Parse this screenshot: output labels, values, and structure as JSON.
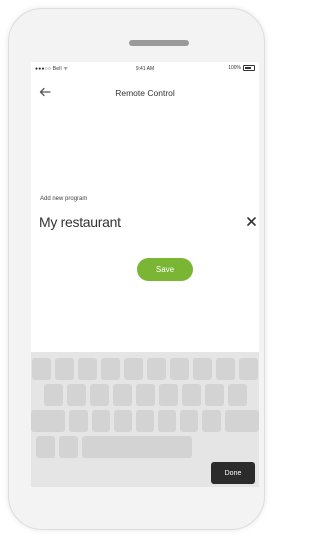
{
  "status_bar": {
    "carrier": "●●●○○ Bell ᯤ",
    "time": "9:41 AM",
    "battery": "100%"
  },
  "header": {
    "back_icon": "back-arrow-icon",
    "title": "Remote Control"
  },
  "form": {
    "label": "Add new program",
    "value": "My restaurant",
    "clear_icon": "close-icon"
  },
  "buttons": {
    "save_label": "Save"
  },
  "keyboard": {
    "done_label": "Done"
  },
  "colors": {
    "accent_green": "#7ab534",
    "done_key": "#2b2b2b",
    "keyboard_bg": "#e5e5e5"
  }
}
